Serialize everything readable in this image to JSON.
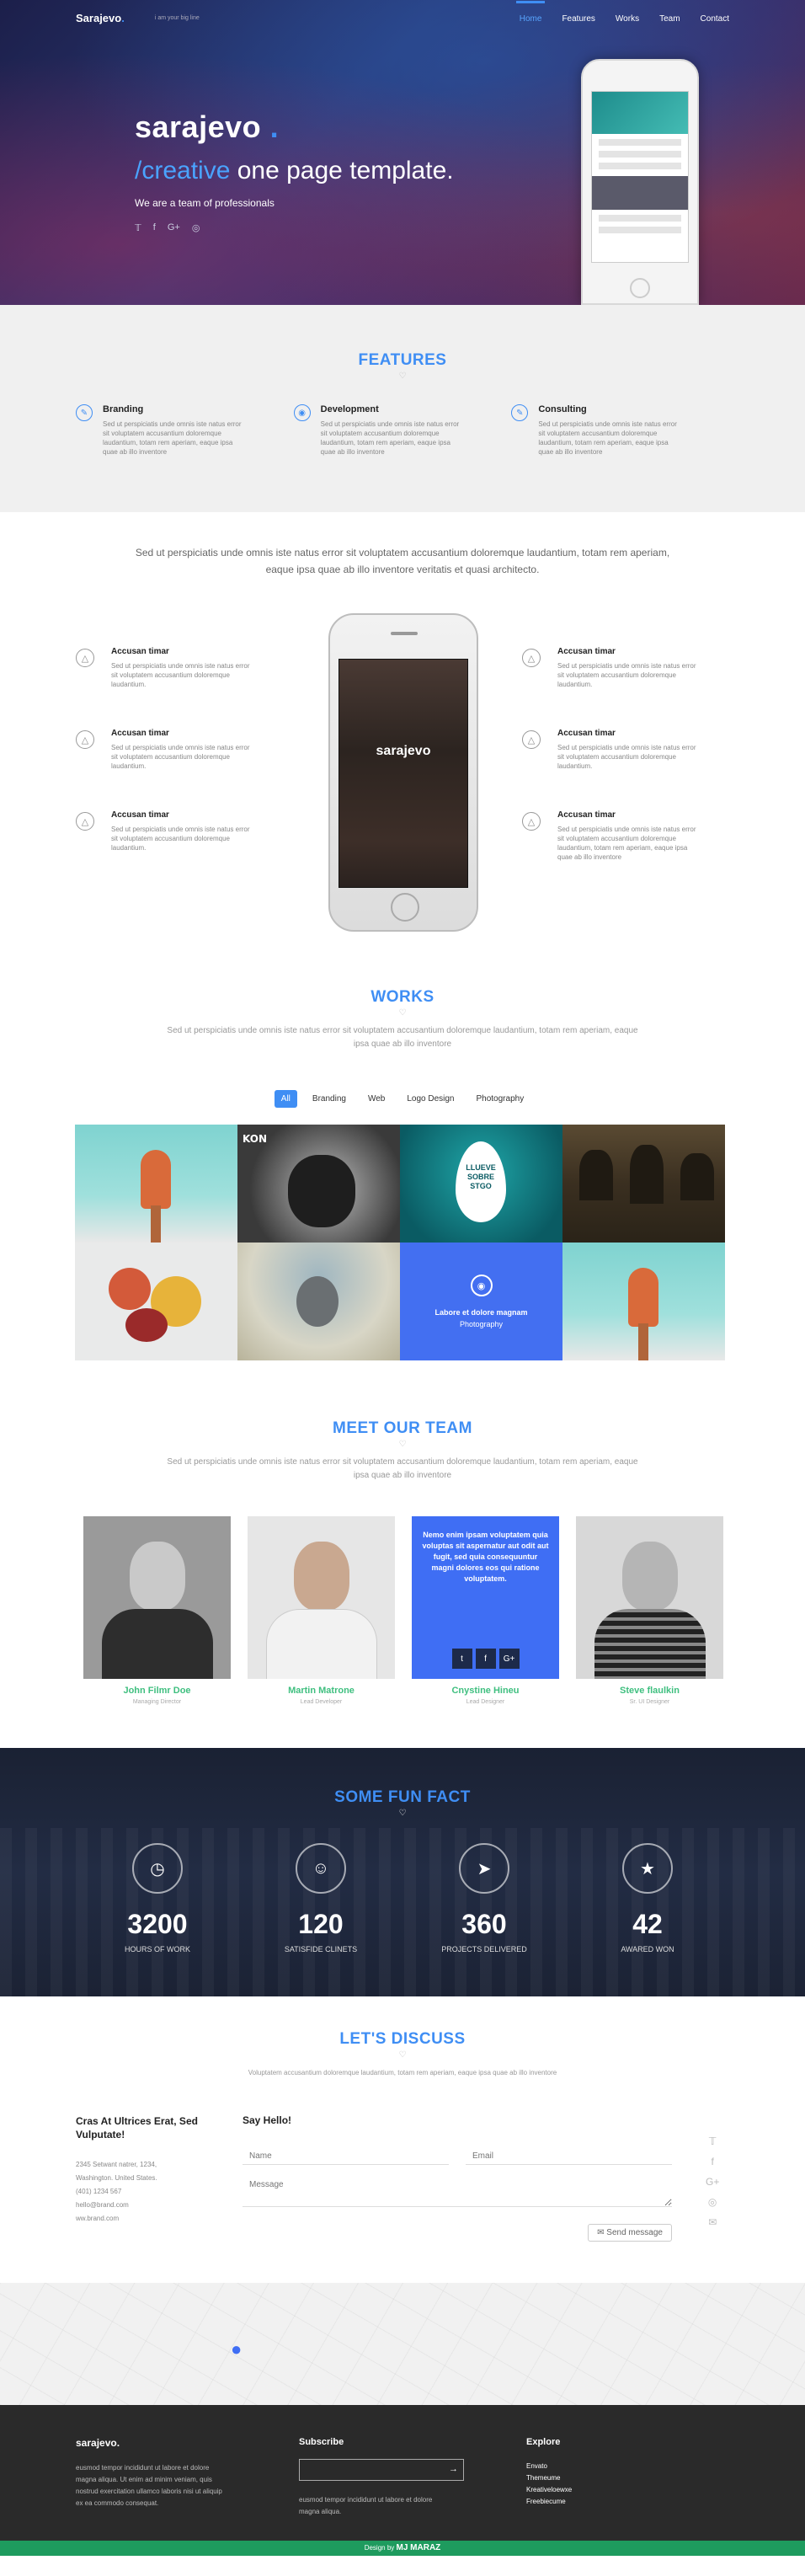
{
  "nav": {
    "brand": "Sarajevo",
    "tagline": "i am your big line",
    "items": [
      "Home",
      "Features",
      "Works",
      "Team",
      "Contact"
    ]
  },
  "hero": {
    "title": "sarajevo",
    "title_dot": ".",
    "subtitle_accent": "/creative",
    "subtitle_rest": " one page template.",
    "tagline": "We are a team of professionals",
    "social": [
      "twitter-icon",
      "facebook-icon",
      "google-plus-icon",
      "dribbble-icon"
    ]
  },
  "features": {
    "title": "FEATURES",
    "items": [
      {
        "title": "Branding",
        "text": "Sed ut perspiciatis unde omnis iste natus error sit voluptatem accusantium doloremque laudantium, totam rem aperiam, eaque ipsa quae ab illo inventore"
      },
      {
        "title": "Development",
        "text": "Sed ut perspiciatis unde omnis iste natus error sit voluptatem accusantium doloremque laudantium, totam rem aperiam, eaque ipsa quae ab illo inventore"
      },
      {
        "title": "Consulting",
        "text": "Sed ut perspiciatis unde omnis iste natus error sit voluptatem accusantium doloremque laudantium, totam rem aperiam, eaque ipsa quae ab illo inventore"
      }
    ]
  },
  "intro": {
    "text": "Sed ut perspiciatis unde omnis iste natus error sit voluptatem accusantium doloremque laudantium, totam rem aperiam, eaque ipsa quae ab illo inventore veritatis et quasi architecto.",
    "phone_title": "sarajevo",
    "left": [
      {
        "title": "Accusan timar",
        "text": "Sed ut perspiciatis unde omnis iste natus error sit voluptatem accusantium doloremque laudantium."
      },
      {
        "title": "Accusan timar",
        "text": "Sed ut perspiciatis unde omnis iste natus error sit voluptatem accusantium doloremque laudantium."
      },
      {
        "title": "Accusan timar",
        "text": "Sed ut perspiciatis unde omnis iste natus error sit voluptatem accusantium doloremque laudantium."
      }
    ],
    "right": [
      {
        "title": "Accusan timar",
        "text": "Sed ut perspiciatis unde omnis iste natus error sit voluptatem accusantium doloremque laudantium."
      },
      {
        "title": "Accusan timar",
        "text": "Sed ut perspiciatis unde omnis iste natus error sit voluptatem accusantium doloremque laudantium."
      },
      {
        "title": "Accusan timar",
        "text": "Sed ut perspiciatis unde omnis iste natus error sit voluptatem accusantium doloremque laudantium, totam rem aperiam, eaque ipsa quae ab illo inventore"
      }
    ]
  },
  "works": {
    "title": "WORKS",
    "sub": "Sed ut perspiciatis unde omnis iste natus error sit voluptatem accusantium doloremque laudantium, totam rem aperiam, eaque ipsa quae ab illo inventore",
    "filters": [
      "All",
      "Branding",
      "Web",
      "Logo Design",
      "Photography"
    ],
    "overlay_title": "Labore et dolore magnam",
    "overlay_cat": "Photography",
    "tile_text": "LLUEVE SOBRE STGO"
  },
  "team": {
    "title": "MEET OUR TEAM",
    "sub": "Sed ut perspiciatis unde omnis iste natus error sit voluptatem accusantium doloremque laudantium, totam rem aperiam, eaque ipsa quae ab illo inventore",
    "hover_text": "Nemo enim ipsam voluptatem quia voluptas sit aspernatur aut odit aut fugit, sed quia consequuntur magni dolores eos qui ratione voluptatem.",
    "members": [
      {
        "name": "John Filmr Doe",
        "role": "Managing Director"
      },
      {
        "name": "Martin Matrone",
        "role": "Lead Developer"
      },
      {
        "name": "Cnystine Hineu",
        "role": "Lead Designer"
      },
      {
        "name": "Steve flaulkin",
        "role": "Sr. UI Designer"
      }
    ]
  },
  "facts": {
    "title": "SOME FUN FACT",
    "items": [
      {
        "icon": "clock-icon",
        "value": "3200",
        "label": "HOURS OF WORK"
      },
      {
        "icon": "user-icon",
        "value": "120",
        "label": "SATISFIDE CLINETS"
      },
      {
        "icon": "rocket-icon",
        "value": "360",
        "label": "PROJECTS DELIVERED"
      },
      {
        "icon": "award-icon",
        "value": "42",
        "label": "AWARED WON"
      }
    ]
  },
  "contact": {
    "title": "LET'S DISCUSS",
    "sub": "Voluptatem accusantium doloremque laudantium, totam rem aperiam, eaque ipsa quae ab illo inventore",
    "heading": "Cras At Ultrices Erat, Sed Vulputate!",
    "address": [
      "2345 Setwant natrer, 1234,",
      "Washington. United States.",
      "(401) 1234 567",
      "hello@brand.com",
      "ww.brand.com"
    ],
    "form_title": "Say Hello!",
    "name_placeholder": "Name",
    "email_placeholder": "Email",
    "message_placeholder": "Message",
    "send": "Send message"
  },
  "footer": {
    "brand": "sarajevo.",
    "about": "eusmod tempor incididunt ut labore et dolore magna aliqua. Ut enim ad minim veniam, quis nostrud exercitation ullamco laboris nisi ut aliquip ex ea commodo consequat.",
    "subscribe_title": "Subscribe",
    "subscribe_text": "eusmod tempor incididunt ut labore et dolore magna aliqua.",
    "explore_title": "Explore",
    "links": [
      "Envato",
      "Themeume",
      "Kreativeloewxe",
      "Freebiecume"
    ],
    "credit_prefix": "Design by",
    "credit_name": "MJ MARAZ"
  },
  "colors": {
    "accent": "#3f8ef4",
    "green": "#3fbf7f",
    "footer": "#2a2a2a"
  }
}
